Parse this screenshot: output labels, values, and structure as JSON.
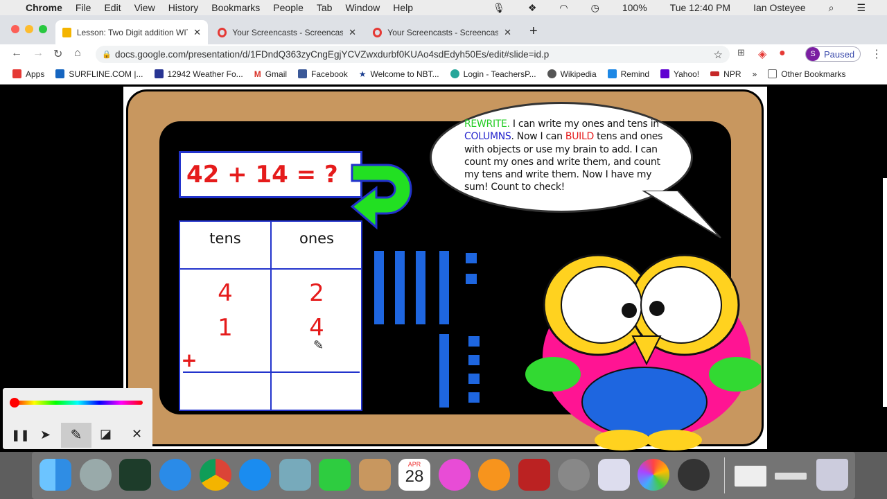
{
  "menubar": {
    "app": "Chrome",
    "items": [
      "File",
      "Edit",
      "View",
      "History",
      "Bookmarks",
      "People",
      "Tab",
      "Window",
      "Help"
    ],
    "battery": "100%",
    "clock": "Tue 12:40 PM",
    "user": "Ian Osteyee"
  },
  "tabs": [
    {
      "title": "Lesson: Two Digit addition WIT",
      "active": true
    },
    {
      "title": "Your Screencasts - Screencast",
      "active": false
    },
    {
      "title": "Your Screencasts - Screencast",
      "active": false
    }
  ],
  "toolbar": {
    "url": "docs.google.com/presentation/d/1FDndQ363zyCngEgjYCVZwxdurbf0KUAo4sdEdyh50Es/edit#slide=id.p",
    "profile_initial": "S",
    "profile_status": "Paused"
  },
  "bookmarks": [
    {
      "label": "Apps",
      "color": "#e53935"
    },
    {
      "label": "SURFLINE.COM |...",
      "color": "#1565c0"
    },
    {
      "label": "12942 Weather Fo...",
      "color": "#283593"
    },
    {
      "label": "Gmail",
      "color": "#d93025"
    },
    {
      "label": "Facebook",
      "color": "#3b5998"
    },
    {
      "label": "Welcome to NBT...",
      "color": "#1a3d8f"
    },
    {
      "label": "Login - TeachersP...",
      "color": "#26a69a"
    },
    {
      "label": "Wikipedia",
      "color": "#555"
    },
    {
      "label": "Remind",
      "color": "#1e88e5"
    },
    {
      "label": "Yahoo!",
      "color": "#5f01d1"
    },
    {
      "label": "NPR",
      "color": "#c62828"
    }
  ],
  "bookmarks_more": "»",
  "other_bookmarks": "Other Bookmarks",
  "slide": {
    "equation": "42  +  14  = ?",
    "headers": [
      "tens",
      "ones"
    ],
    "row1": [
      "4",
      "2"
    ],
    "row2": [
      "1",
      "4"
    ],
    "plus": "+",
    "bubble": {
      "w1": "REWRITE.",
      "t1": " I can write my  ones and tens in ",
      "w2": "COLUMNS",
      "t2": ". Now I can  ",
      "w3": "BUILD",
      "t3": " tens and ones with objects or use my brain to add. I  can count my ones and write them, and count my tens and write them. Now I have  my sum!  Count to check!"
    },
    "colors": {
      "green": "#22cc22",
      "blue": "#2222cc",
      "red": "#e51b1b"
    }
  },
  "dock": {
    "calendar_month": "APR",
    "calendar_day": "28"
  }
}
